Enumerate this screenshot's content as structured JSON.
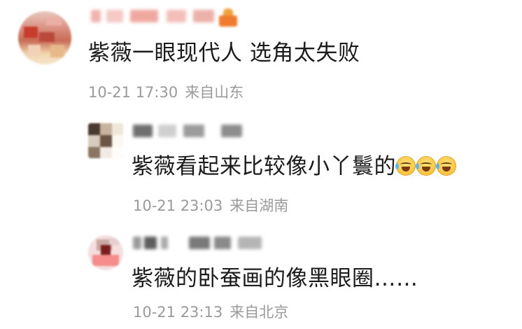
{
  "comments": [
    {
      "text": "紫薇一眼现代人 选角太失败",
      "time": "10-21 17:30",
      "location": "来自山东"
    }
  ],
  "replies": [
    {
      "text": "紫薇看起来比较像小丫鬟的",
      "emoji": [
        "laugh-cry-emoji",
        "laugh-cry-emoji",
        "laugh-cry-emoji"
      ],
      "time": "10-21 23:03",
      "location": "来自湖南"
    },
    {
      "text": "紫薇的卧蚕画的像黑眼圈……",
      "time": "10-21 23:13",
      "location": "来自北京"
    }
  ],
  "colors": {
    "text": "#1b1b1b",
    "meta": "#9a9a9a",
    "background": "#ffffff"
  }
}
